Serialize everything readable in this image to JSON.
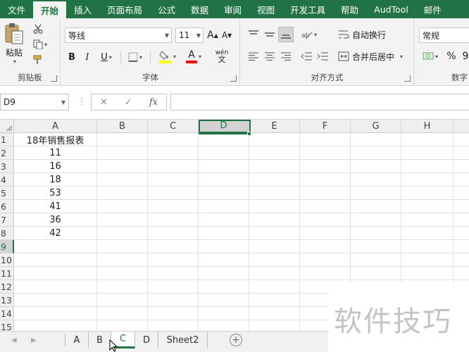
{
  "ribbon_tabs": [
    "文件",
    "开始",
    "插入",
    "页面布局",
    "公式",
    "数据",
    "审阅",
    "视图",
    "开发工具",
    "帮助",
    "AudTool",
    "邮件"
  ],
  "active_ribbon_tab": "开始",
  "clipboard": {
    "paste_label": "粘贴",
    "group_label": "剪贴板"
  },
  "font_group": {
    "font_name": "等线",
    "font_size": "11",
    "grow_label": "A",
    "shrink_label": "A",
    "bold": "B",
    "italic": "I",
    "underline": "U",
    "font_color_letter": "A",
    "phonetic_label": "wén",
    "group_label": "字体"
  },
  "alignment_group": {
    "wrap_label": "自动换行",
    "merge_label": "合并后居中",
    "group_label": "对齐方式"
  },
  "number_group": {
    "format": "常规",
    "percent": "%",
    "comma": "9",
    "group_label": "数字"
  },
  "colors": {
    "accent": "#217346",
    "ribbon_bg": "#f3f3f3",
    "fill_yellow": "#ffff00",
    "font_red": "#ff0000"
  },
  "formula_bar": {
    "name_box": "D9",
    "formula": "",
    "fx_label": "fx"
  },
  "columns": [
    "A",
    "B",
    "C",
    "D",
    "E",
    "F",
    "G",
    "H"
  ],
  "selected_column": "D",
  "rows": [
    "1",
    "2",
    "3",
    "4",
    "5",
    "6",
    "7",
    "8",
    "9",
    "10",
    "11",
    "12",
    "13",
    "14",
    "15"
  ],
  "selected_row": "9",
  "cells_col_a": [
    "18年销售报表",
    "11",
    "16",
    "18",
    "53",
    "41",
    "36",
    "42"
  ],
  "sheet_tabs": [
    "A",
    "B",
    "C",
    "D",
    "Sheet2"
  ],
  "active_sheet": "C",
  "add_sheet_label": "+",
  "watermark": "软件技巧"
}
